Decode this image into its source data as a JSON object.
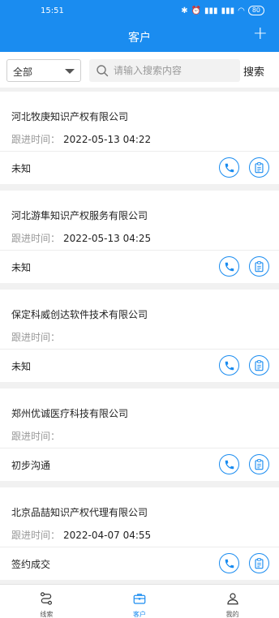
{
  "status_bar": {
    "time": "15:51",
    "battery": "80"
  },
  "header": {
    "title": "客户",
    "add_label": "+"
  },
  "search": {
    "filter_value": "全部",
    "placeholder": "请输入搜索内容",
    "button_label": "搜索"
  },
  "follow_label": "跟进时间：",
  "customers": [
    {
      "name": "河北牧庚知识产权有限公司",
      "follow_time": "2022-05-13 04:22",
      "status": "未知"
    },
    {
      "name": "河北游隼知识产权服务有限公司",
      "follow_time": "2022-05-13 04:25",
      "status": "未知"
    },
    {
      "name": "保定科威创达软件技术有限公司",
      "follow_time": "",
      "status": "未知"
    },
    {
      "name": "郑州优诚医疗科技有限公司",
      "follow_time": "",
      "status": "初步沟通"
    },
    {
      "name": "北京品喆知识产权代理有限公司",
      "follow_time": "2022-04-07 04:55",
      "status": "签约成交"
    }
  ],
  "tabs": [
    {
      "label": "线索",
      "icon": "route-icon",
      "active": false
    },
    {
      "label": "客户",
      "icon": "briefcase-icon",
      "active": true
    },
    {
      "label": "我的",
      "icon": "user-icon",
      "active": false
    }
  ],
  "colors": {
    "primary": "#1a8cf0",
    "text": "#222222",
    "muted": "#999999"
  }
}
